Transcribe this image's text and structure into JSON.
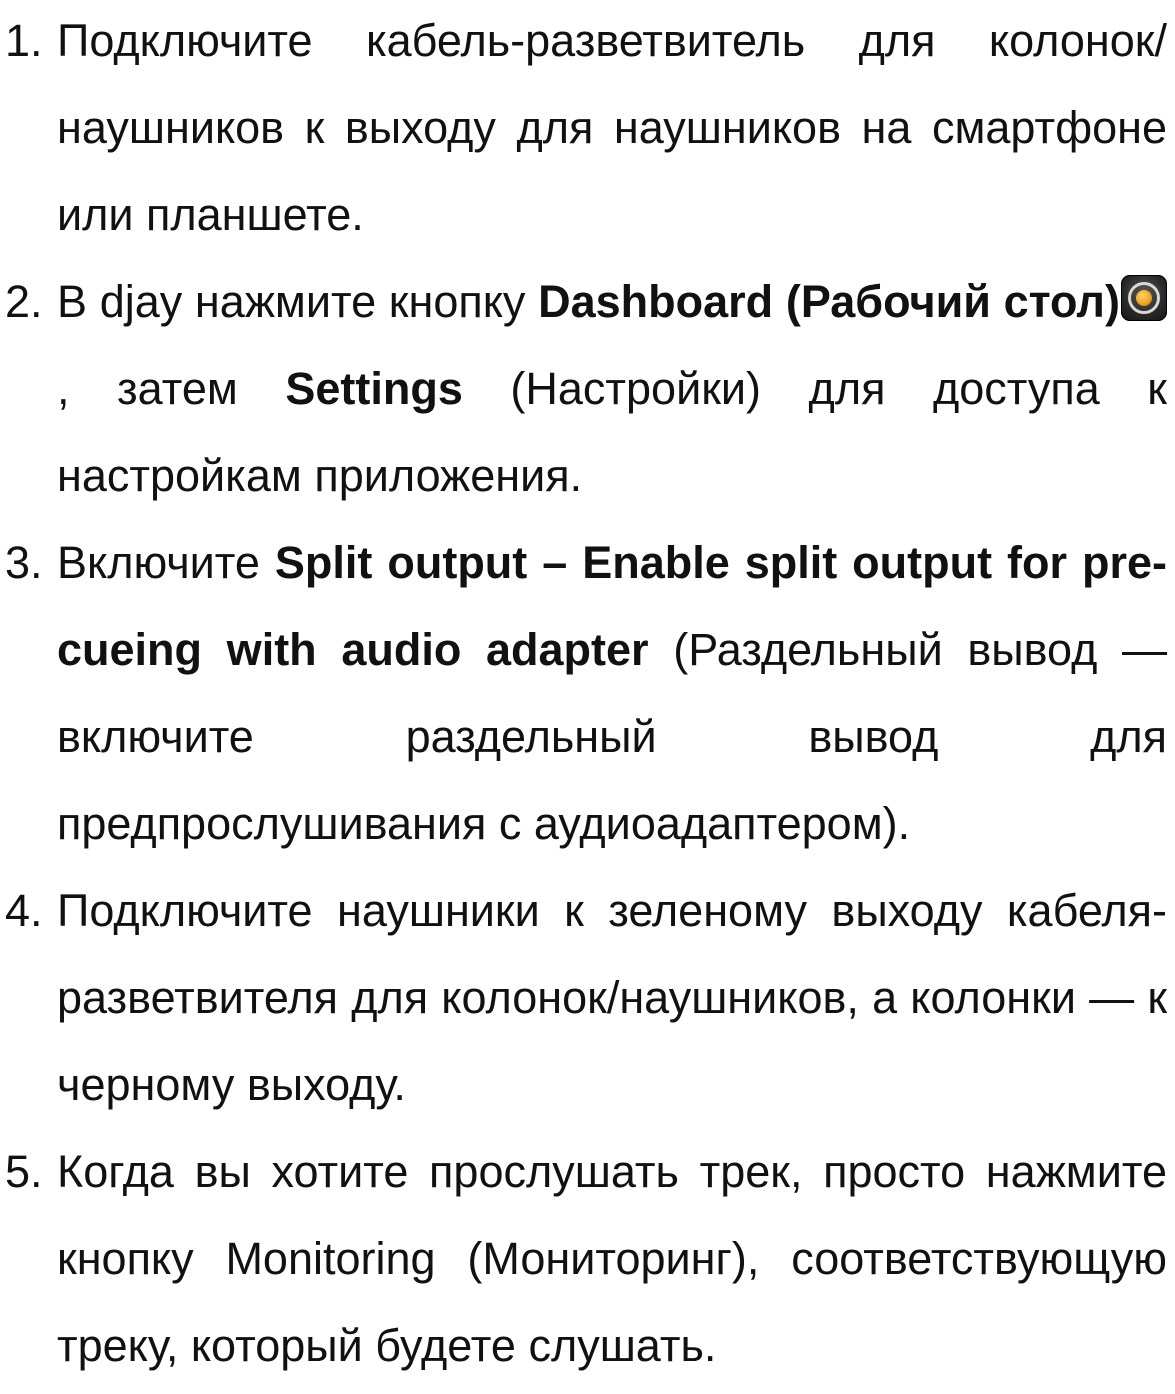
{
  "steps": [
    {
      "number": "1.",
      "text": "Подключите кабель-разветвитель для колонок/наушников к выходу для наушников на смартфоне или планшете."
    },
    {
      "number": "2.",
      "t1": "В djay нажмите кнопку ",
      "b1": "Dashboard (Рабочий стол)",
      "icon": "dashboard-icon",
      "t2": ", затем ",
      "b2": "Settings",
      "t3": " (Настройки) для доступа к настройкам приложения."
    },
    {
      "number": "3.",
      "t1": "Включите ",
      "b1": "Split output – Enable split output for pre-cueing with audio adapter",
      "t2": " (Раздельный вывод — включите раздельный вывод для предпрослушивания с аудиоадаптером)."
    },
    {
      "number": "4.",
      "text": "Подключите наушники к зеленому выходу кабеля-разветвителя для колонок/наушников, а колонки — к черному выходу."
    },
    {
      "number": "5.",
      "text": "Когда вы хотите прослушать трек, просто нажмите кнопку Monitoring (Мониторинг), соответствующую треку, который будете слушать."
    }
  ]
}
